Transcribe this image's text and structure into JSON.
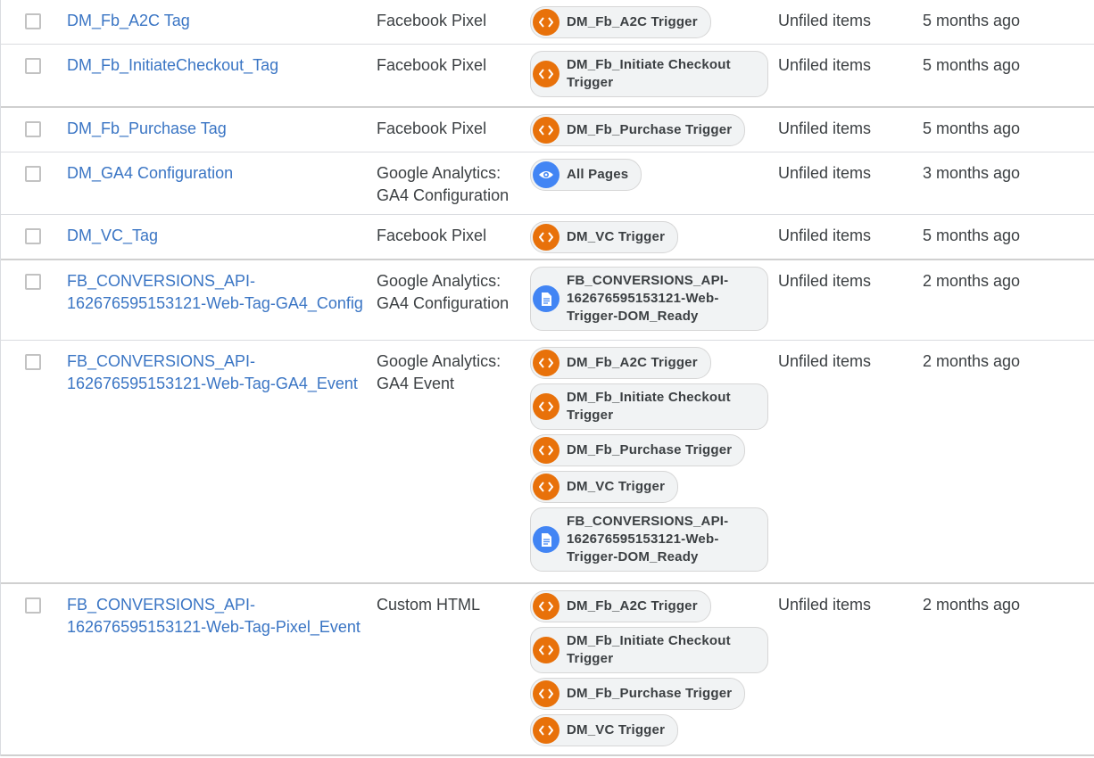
{
  "rows": [
    {
      "name": "DM_Fb_A2C Tag",
      "type": "Facebook Pixel",
      "folder": "Unfiled items",
      "edited": "5 months ago",
      "triggers": [
        {
          "label": "DM_Fb_A2C Trigger",
          "icon": "code-icon"
        }
      ]
    },
    {
      "name": "DM_Fb_InitiateCheckout_Tag",
      "type": "Facebook Pixel",
      "folder": "Unfiled items",
      "edited": "5 months ago",
      "triggers": [
        {
          "label": "DM_Fb_Initiate Checkout Trigger",
          "icon": "code-icon"
        }
      ]
    },
    {
      "name": "DM_Fb_Purchase Tag",
      "type": "Facebook Pixel",
      "folder": "Unfiled items",
      "edited": "5 months ago",
      "triggers": [
        {
          "label": "DM_Fb_Purchase Trigger",
          "icon": "code-icon"
        }
      ]
    },
    {
      "name": "DM_GA4 Configuration",
      "type": "Google Analytics: GA4 Configuration",
      "folder": "Unfiled items",
      "edited": "3 months ago",
      "triggers": [
        {
          "label": "All Pages",
          "icon": "eye-icon"
        }
      ]
    },
    {
      "name": "DM_VC_Tag",
      "type": "Facebook Pixel",
      "folder": "Unfiled items",
      "edited": "5 months ago",
      "triggers": [
        {
          "label": "DM_VC Trigger",
          "icon": "code-icon"
        }
      ]
    },
    {
      "name": "FB_CONVERSIONS_API-162676595153121-Web-Tag-GA4_Config",
      "type": "Google Analytics: GA4 Configuration",
      "folder": "Unfiled items",
      "edited": "2 months ago",
      "triggers": [
        {
          "label": "FB_CONVERSIONS_API-162676595153121-Web-Trigger-DOM_Ready",
          "icon": "document-icon"
        }
      ]
    },
    {
      "name": "FB_CONVERSIONS_API-162676595153121-Web-Tag-GA4_Event",
      "type": "Google Analytics: GA4 Event",
      "folder": "Unfiled items",
      "edited": "2 months ago",
      "triggers": [
        {
          "label": "DM_Fb_A2C Trigger",
          "icon": "code-icon"
        },
        {
          "label": "DM_Fb_Initiate Checkout Trigger",
          "icon": "code-icon"
        },
        {
          "label": "DM_Fb_Purchase Trigger",
          "icon": "code-icon"
        },
        {
          "label": "DM_VC Trigger",
          "icon": "code-icon"
        },
        {
          "label": "FB_CONVERSIONS_API-162676595153121-Web-Trigger-DOM_Ready",
          "icon": "document-icon"
        }
      ]
    },
    {
      "name": "FB_CONVERSIONS_API-162676595153121-Web-Tag-Pixel_Event",
      "type": "Custom HTML",
      "folder": "Unfiled items",
      "edited": "2 months ago",
      "triggers": [
        {
          "label": "DM_Fb_A2C Trigger",
          "icon": "code-icon"
        },
        {
          "label": "DM_Fb_Initiate Checkout Trigger",
          "icon": "code-icon"
        },
        {
          "label": "DM_Fb_Purchase Trigger",
          "icon": "code-icon"
        },
        {
          "label": "DM_VC Trigger",
          "icon": "code-icon"
        }
      ]
    }
  ],
  "colors": {
    "link": "#3a75c4",
    "trigger_orange": "#e8710a",
    "trigger_blue": "#4285f4"
  }
}
